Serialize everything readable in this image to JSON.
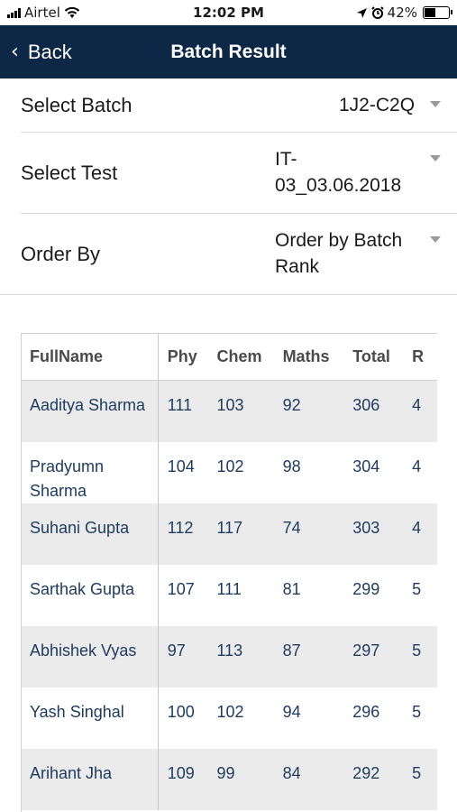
{
  "status_bar": {
    "carrier": "Airtel",
    "time": "12:02 PM",
    "battery_percent": "42%",
    "battery_level": 0.42
  },
  "nav": {
    "back_label": "Back",
    "title": "Batch Result"
  },
  "filters": {
    "batch": {
      "label": "Select Batch",
      "value": "1J2-C2Q"
    },
    "test": {
      "label": "Select Test",
      "value_line1": "IT-",
      "value_line2": "03_03.06.2018"
    },
    "order": {
      "label": "Order By",
      "value_line1": "Order by Batch",
      "value_line2": "Rank"
    }
  },
  "table": {
    "headers": [
      "FullName",
      "Phy",
      "Chem",
      "Maths",
      "Total",
      "R"
    ],
    "rows": [
      {
        "name_line1": "Aaditya Sharma",
        "name_line2": "",
        "phy": "111",
        "chem": "103",
        "maths": "92",
        "total": "306",
        "extra": "4"
      },
      {
        "name_line1": "Pradyumn",
        "name_line2": "Sharma",
        "phy": "104",
        "chem": "102",
        "maths": "98",
        "total": "304",
        "extra": "4"
      },
      {
        "name_line1": "Suhani Gupta",
        "name_line2": "",
        "phy": "112",
        "chem": "117",
        "maths": "74",
        "total": "303",
        "extra": "4"
      },
      {
        "name_line1": "Sarthak Gupta",
        "name_line2": "",
        "phy": "107",
        "chem": "111",
        "maths": "81",
        "total": "299",
        "extra": "5"
      },
      {
        "name_line1": "Abhishek Vyas",
        "name_line2": "",
        "phy": "97",
        "chem": "113",
        "maths": "87",
        "total": "297",
        "extra": "5"
      },
      {
        "name_line1": "Yash Singhal",
        "name_line2": "",
        "phy": "100",
        "chem": "102",
        "maths": "94",
        "total": "296",
        "extra": "5"
      },
      {
        "name_line1": "Arihant Jha",
        "name_line2": "",
        "phy": "109",
        "chem": "99",
        "maths": "84",
        "total": "292",
        "extra": "5"
      }
    ]
  }
}
